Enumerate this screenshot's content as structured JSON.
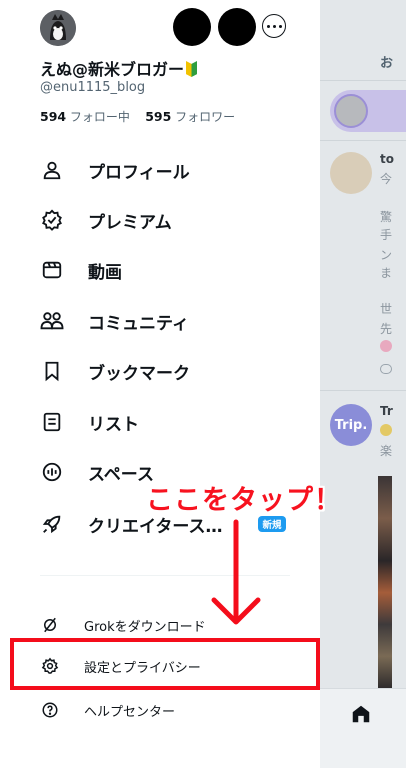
{
  "profile": {
    "name": "えぬ@新米ブロガー",
    "handle": "@enu1115_blog",
    "following_count": "594",
    "following_label": "フォロー中",
    "followers_count": "595",
    "followers_label": "フォロワー"
  },
  "menu": {
    "items": [
      {
        "label": "プロフィール",
        "icon": "person-icon"
      },
      {
        "label": "プレミアム",
        "icon": "verified-badge-icon"
      },
      {
        "label": "動画",
        "icon": "video-icon"
      },
      {
        "label": "コミュニティ",
        "icon": "communities-icon"
      },
      {
        "label": "ブックマーク",
        "icon": "bookmark-icon"
      },
      {
        "label": "リスト",
        "icon": "list-icon"
      },
      {
        "label": "スペース",
        "icon": "spaces-icon"
      },
      {
        "label": "クリエイタース…",
        "icon": "rocket-icon"
      }
    ],
    "new_badge": "新規"
  },
  "submenu": {
    "items": [
      {
        "label": "Grokをダウンロード",
        "icon": "grok-icon"
      },
      {
        "label": "設定とプライバシー",
        "icon": "gear-icon"
      },
      {
        "label": "ヘルプセンター",
        "icon": "help-icon"
      }
    ]
  },
  "annotation": {
    "callout_text": "ここをタップ！",
    "color": "#f40d1b"
  },
  "background": {
    "tab_label": "お",
    "post1_name": "to",
    "post1_time": "今",
    "post1_lines": [
      "驚",
      "手",
      "ン",
      "ま",
      "世",
      "先"
    ],
    "post2_avatar": "Trip.",
    "post2_name": "Tr",
    "post2_line": "楽"
  },
  "colors": {
    "accent": "#1d9bf0",
    "text_primary": "#0f1419",
    "text_secondary": "#536471"
  }
}
